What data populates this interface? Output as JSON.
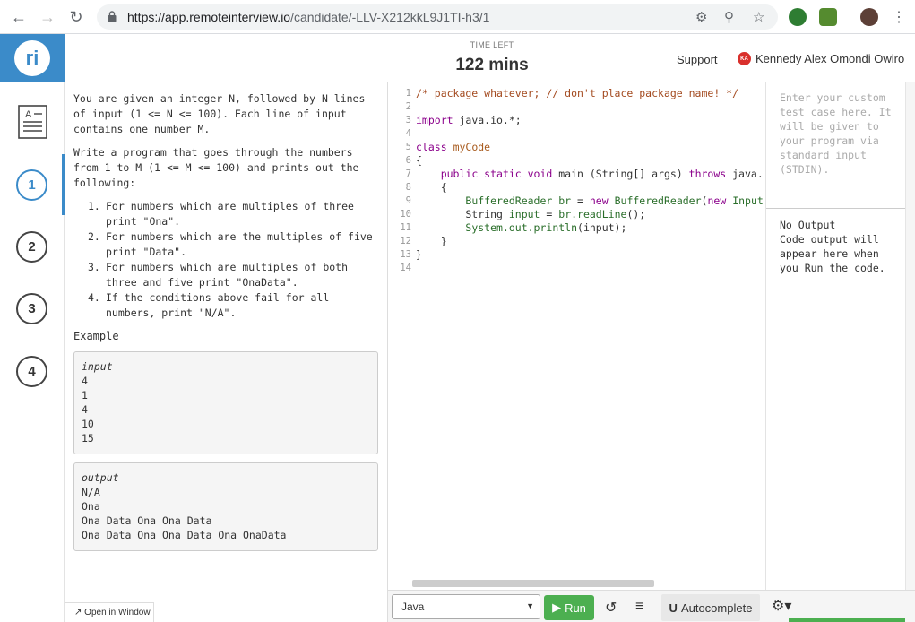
{
  "browser": {
    "url_host": "https://app.remoteinterview.io",
    "url_path": "/candidate/-LLV-X212kkL9J1TI-h3/1"
  },
  "header": {
    "time_label": "TIME LEFT",
    "time_value": "122 mins",
    "support_label": "Support",
    "user_initials": "KA",
    "user_name": "Kennedy Alex Omondi Owiro",
    "logo_text": "ri"
  },
  "rail": {
    "questions": [
      "1",
      "2",
      "3",
      "4"
    ],
    "active_index": 0
  },
  "problem": {
    "para1": "You are given an integer N, followed by N lines of input (1 <= N <= 100). Each line of input contains one number M.",
    "para2": "Write a program that goes through the numbers from 1 to M (1 <= M <= 100) and prints out the following:",
    "list": [
      {
        "num": "1.",
        "text": "For numbers which are multiples of three print \"Ona\"."
      },
      {
        "num": "2.",
        "text": "For numbers which are the multiples of five print \"Data\"."
      },
      {
        "num": "3.",
        "text": "For numbers which are multiples of both three and five print \"OnaData\"."
      },
      {
        "num": "4.",
        "text": "If the conditions above fail for all numbers, print \"N/A\"."
      }
    ],
    "example_title": "Example",
    "input_title": "input",
    "input_lines": [
      "4",
      "1",
      "4",
      "10",
      "15"
    ],
    "output_title": "output",
    "output_lines": [
      "N/A",
      "Ona",
      "Ona Data Ona Ona Data",
      "Ona Data Ona Ona Data Ona OnaData"
    ],
    "open_window_label": "Open in Window"
  },
  "editor": {
    "line_numbers": [
      "1",
      "2",
      "3",
      "4",
      "5",
      "6",
      "7",
      "8",
      "9",
      "10",
      "11",
      "12",
      "13",
      "14"
    ]
  },
  "right_panel": {
    "stdin_placeholder": "Enter your custom test case here. It will be given to your program via standard input (STDIN).",
    "output_status": "No Output",
    "output_hint": "Code output will appear here when you Run the code."
  },
  "toolbar": {
    "language": "Java",
    "run_label": "Run",
    "autocomplete_label": "Autocomplete"
  },
  "colors": {
    "brand": "#3b8bc9",
    "run_green": "#4caf50"
  }
}
